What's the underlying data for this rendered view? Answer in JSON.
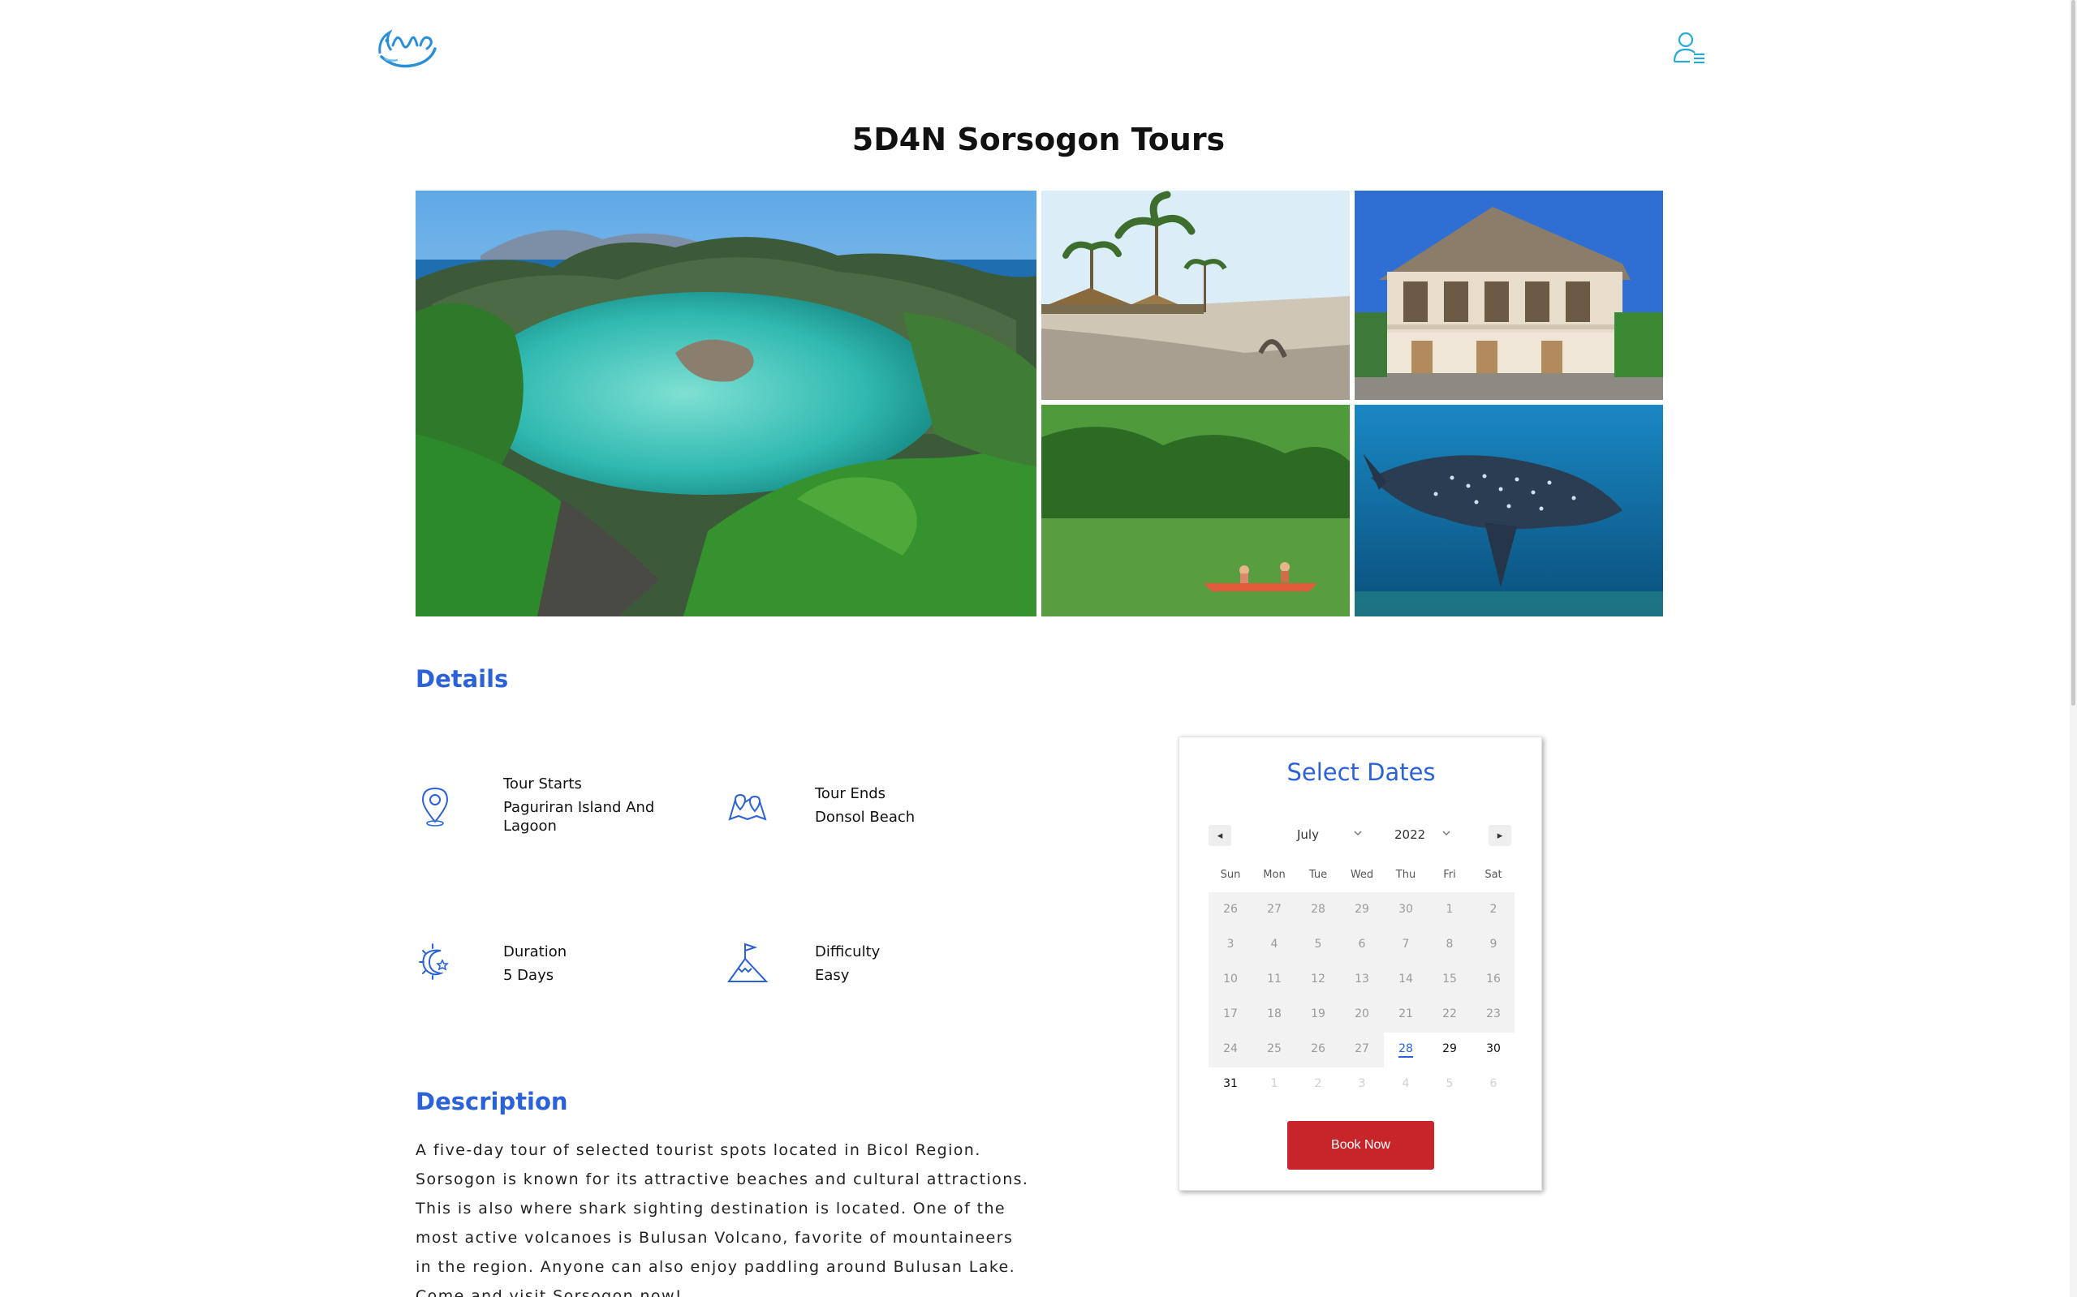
{
  "header": {
    "logo": "baybayin-wave-logo",
    "account_icon": "user-menu-icon"
  },
  "page_title": "5D4N Sorsogon Tours",
  "gallery": {
    "photos": [
      "lagoon-photo",
      "beach-photo",
      "heritage-house-photo",
      "kayak-river-photo",
      "whale-shark-photo"
    ]
  },
  "details": {
    "heading": "Details",
    "items": [
      {
        "label": "Tour Starts",
        "value_line1": "Paguriran Island And",
        "value_line2": "Lagoon",
        "icon": "location-pin-icon"
      },
      {
        "label": "Tour Ends",
        "value_line1": "Donsol Beach",
        "icon": "map-pins-icon"
      },
      {
        "label": "Duration",
        "value_line1": "5 Days",
        "icon": "sun-moon-icon"
      },
      {
        "label": "Difficulty",
        "value_line1": "Easy",
        "icon": "mountain-flag-icon"
      }
    ]
  },
  "description": {
    "heading": "Description",
    "text": "A five-day tour of selected tourist spots located in Bicol Region. Sorsogon is known for its attractive beaches and cultural attractions. This is also where shark sighting destination is located. One of the most active volcanoes is Bulusan Volcano, favorite of mountaineers in the region. Anyone can also enjoy paddling around Bulusan Lake. Come and visit Sorsogon now!"
  },
  "booking": {
    "title": "Select Dates",
    "prev_label": "◂",
    "next_label": "▸",
    "month": "July",
    "year": "2022",
    "weekdays": [
      "Sun",
      "Mon",
      "Tue",
      "Wed",
      "Thu",
      "Fri",
      "Sat"
    ],
    "weeks": [
      [
        "26",
        "27",
        "28",
        "29",
        "30",
        "1",
        "2"
      ],
      [
        "3",
        "4",
        "5",
        "6",
        "7",
        "8",
        "9"
      ],
      [
        "10",
        "11",
        "12",
        "13",
        "14",
        "15",
        "16"
      ],
      [
        "17",
        "18",
        "19",
        "20",
        "21",
        "22",
        "23"
      ],
      [
        "24",
        "25",
        "26",
        "27",
        "28",
        "29",
        "30"
      ],
      [
        "31",
        "1",
        "2",
        "3",
        "4",
        "5",
        "6"
      ]
    ],
    "selected_day": "28",
    "book_label": "Book Now"
  },
  "colors": {
    "accent": "#2b62d9",
    "button": "#c8252a",
    "logo": "#2a8fd6"
  }
}
